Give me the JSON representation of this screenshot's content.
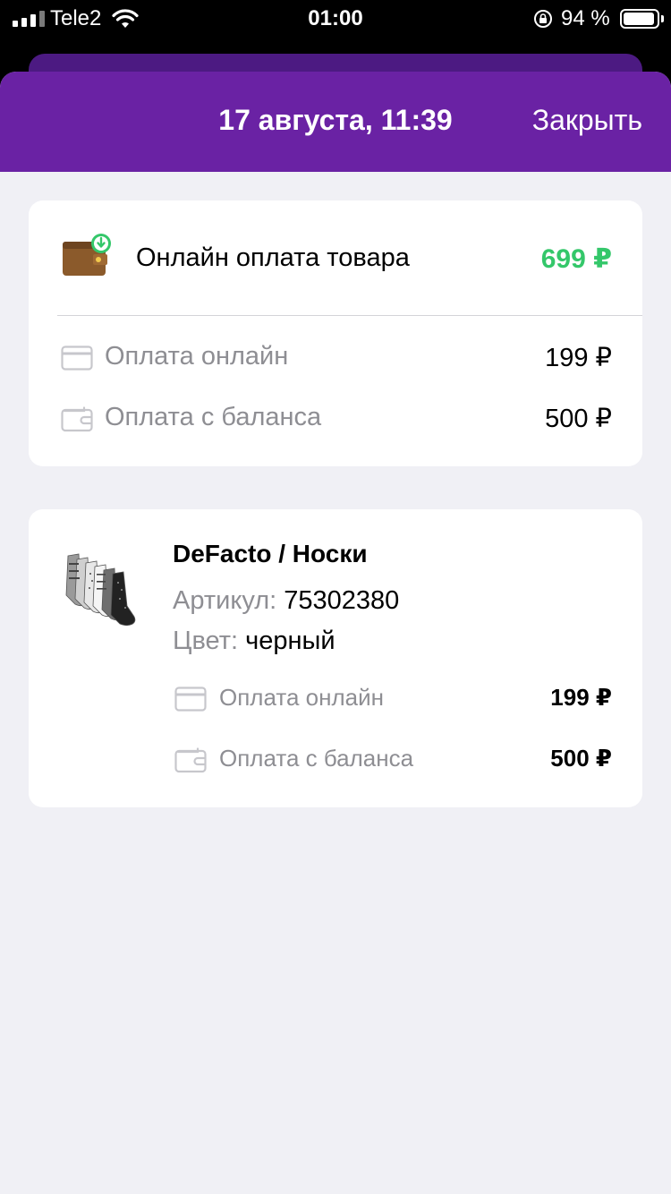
{
  "status_bar": {
    "carrier": "Tele2",
    "time": "01:00",
    "battery": "94 %",
    "battery_level_percent": 94
  },
  "header": {
    "title": "17 августа, 11:39",
    "close_label": "Закрыть",
    "color": "#6a22a4"
  },
  "summary": {
    "icon": "wallet-download-icon",
    "title": "Онлайн оплата товара",
    "total": "699 ₽",
    "total_color": "#34c76a",
    "payments": [
      {
        "icon": "card-icon",
        "label": "Оплата онлайн",
        "amount": "199 ₽"
      },
      {
        "icon": "wallet-icon",
        "label": "Оплата с баланса",
        "amount": "500 ₽"
      }
    ]
  },
  "product": {
    "image": "socks-image",
    "name": "DeFacto / Носки",
    "article_label": "Артикул:",
    "article_value": "75302380",
    "color_label": "Цвет:",
    "color_value": "черный",
    "payments": [
      {
        "icon": "card-icon",
        "label": "Оплата онлайн",
        "amount": "199 ₽"
      },
      {
        "icon": "wallet-icon",
        "label": "Оплата с баланса",
        "amount": "500 ₽"
      }
    ]
  }
}
